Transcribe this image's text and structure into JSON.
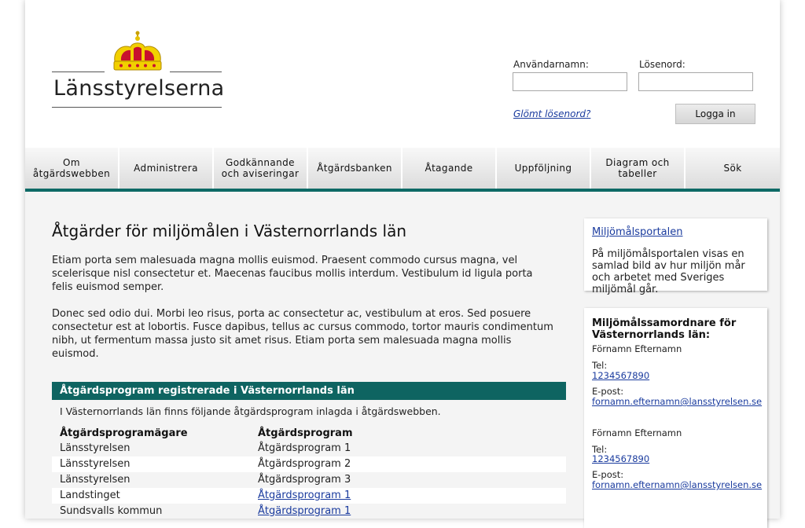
{
  "brand": {
    "logo_text": "Länsstyrelserna"
  },
  "login": {
    "username_label": "Användarnamn:",
    "password_label": "Lösenord:",
    "username_value": "",
    "password_value": "",
    "forgot_label": "Glömt lösenord?",
    "login_button": "Logga in"
  },
  "nav": {
    "items": [
      {
        "line1": "Om",
        "line2": "åtgärdswebben"
      },
      {
        "line1": "Administrera",
        "line2": ""
      },
      {
        "line1": "Godkännande",
        "line2": "och aviseringar"
      },
      {
        "line1": "Åtgärdsbanken",
        "line2": ""
      },
      {
        "line1": "Åtagande",
        "line2": ""
      },
      {
        "line1": "Uppföljning",
        "line2": ""
      },
      {
        "line1": "Diagram och",
        "line2": "tabeller"
      },
      {
        "line1": "Sök",
        "line2": ""
      }
    ]
  },
  "main": {
    "title": "Åtgärder för miljömålen i Västernorrlands län",
    "paragraph1": "Etiam porta sem malesuada magna mollis euismod. Praesent commodo cursus magna, vel scelerisque nisl consectetur et. Maecenas faucibus mollis interdum. Vestibulum id ligula porta felis euismod semper.",
    "paragraph2": "Donec sed odio dui. Morbi leo risus, porta ac consectetur ac, vestibulum at eros. Sed posuere consectetur est at lobortis. Fusce dapibus, tellus ac cursus commodo, tortor mauris condimentum nibh, ut fermentum massa justo sit amet risus. Etiam porta sem malesuada magna mollis euismod.",
    "programs": {
      "header": "Åtgärdsprogram registrerade i Västernorrlands län",
      "intro": "I Västernorrlands län finns följande åtgärdsprogram inlagda i åtgärdswebben.",
      "col_owner": "Åtgärdsprogramägare",
      "col_program": "Åtgärdsprogram",
      "rows": [
        {
          "owner": "Länsstyrelsen",
          "program": "Åtgärdsprogram 1"
        },
        {
          "owner": "Länsstyrelsen",
          "program": "Åtgärdsprogram 2"
        },
        {
          "owner": "Länsstyrelsen",
          "program": "Åtgärdsprogram 3"
        },
        {
          "owner": "Landstinget",
          "program": "Åtgärdsprogram 1"
        },
        {
          "owner": "Sundsvalls kommun",
          "program": "Åtgärdsprogram 1"
        }
      ]
    }
  },
  "sidebar": {
    "portal": {
      "link": "Miljömålsportalen",
      "text": "På miljömålsportalen visas en samlad bild av hur miljön mår och arbetet med Sveriges miljömål går."
    },
    "contacts": {
      "title": "Miljömålssamordnare för Västernorrlands län:",
      "people": [
        {
          "name": "Förnamn Efternamn",
          "tel_label": "Tel:",
          "tel": "1234567890",
          "email_label": "E-post:",
          "email": "fornamn.efternamn@lansstyrelsen.se"
        },
        {
          "name": "Förnamn Efternamn",
          "tel_label": "Tel:",
          "tel": "1234567890",
          "email_label": "E-post:",
          "email": "fornamn.efternamn@lansstyrelsen.se"
        }
      ]
    }
  }
}
